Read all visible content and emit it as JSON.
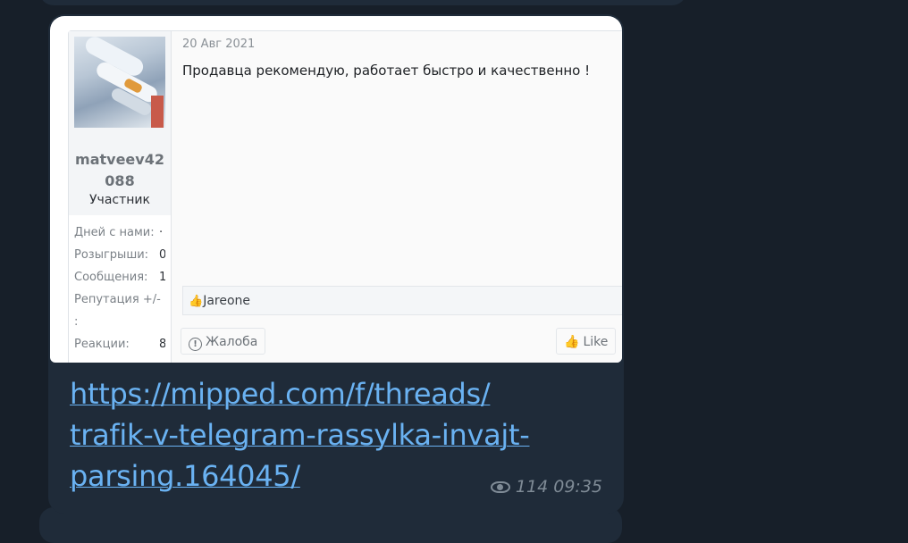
{
  "post": {
    "username": "matveev42088",
    "role": "Участник",
    "stats": [
      {
        "label": "Дней с нами:",
        "value": "·"
      },
      {
        "label": "Розыгрыши:",
        "value": "0"
      },
      {
        "label": "Сообщения:",
        "value": "1"
      },
      {
        "label": "Репутация +/-",
        "value": ""
      },
      {
        "label": ":",
        "value": ""
      },
      {
        "label": "Реакции:",
        "value": "8"
      }
    ],
    "date": "20 Авг 2021",
    "message": "Продавца рекомендую, работает быстро и качественно !",
    "reaction_user": "Jareone",
    "report_label": "Жалоба",
    "like_label": "Like"
  },
  "message": {
    "link": "https://mipped.com/f/threads/trafik-v-telegram-rassylka-invajt-parsing.164045/",
    "link_lines": [
      "https://mipped.com/f/threads/",
      "trafik-v-telegram-rassylka-invajt-",
      "parsing.164045/"
    ],
    "views": "114",
    "time": "09:35"
  }
}
